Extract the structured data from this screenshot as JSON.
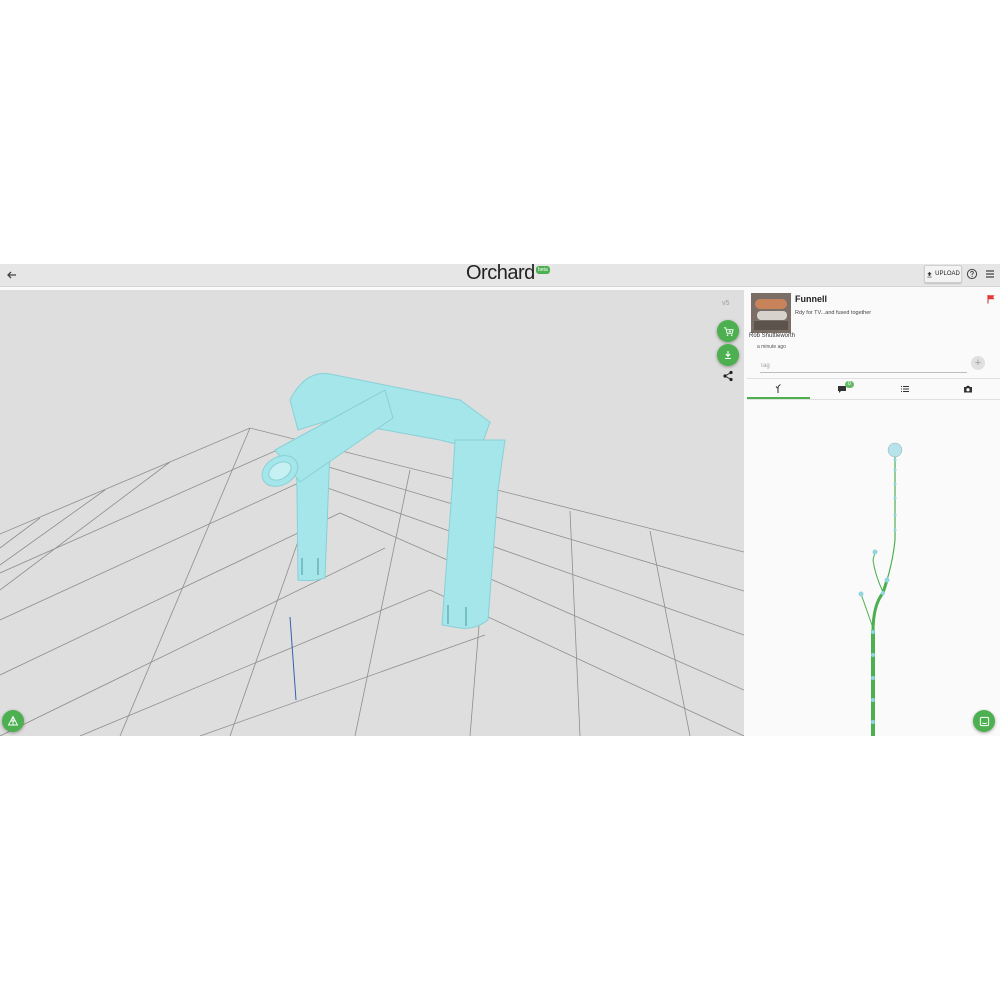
{
  "app": {
    "logo_text": "Orchard",
    "beta_label": "beta",
    "upload_label": "UPLOAD",
    "back_icon": "arrow-left-icon",
    "help_icon": "help-circle-icon",
    "menu_icon": "hamburger-menu-icon"
  },
  "viewport": {
    "version_label": "v5",
    "background": "#dedede",
    "model_color": "#a4e6ea",
    "actions": [
      {
        "name": "add-to-cart",
        "icon": "cart-plus-icon"
      },
      {
        "name": "download",
        "icon": "download-icon"
      },
      {
        "name": "share",
        "icon": "share-icon"
      }
    ],
    "corner_fab_icon": "perspective-icon"
  },
  "post": {
    "title": "Funnell",
    "description": "Rdy for TV...and fused together",
    "author": "Rob Shuttleworth",
    "time": "a minute ago",
    "tag_placeholder": "Tag",
    "add_tag_label": "+"
  },
  "tabs": [
    {
      "name": "history",
      "icon": "tree-icon",
      "active": true
    },
    {
      "name": "comments",
      "icon": "comment-icon",
      "badge": "0"
    },
    {
      "name": "list",
      "icon": "list-icon"
    },
    {
      "name": "photos",
      "icon": "camera-icon"
    }
  ],
  "colors": {
    "accent": "#4caf50",
    "flag": "#e53935"
  }
}
